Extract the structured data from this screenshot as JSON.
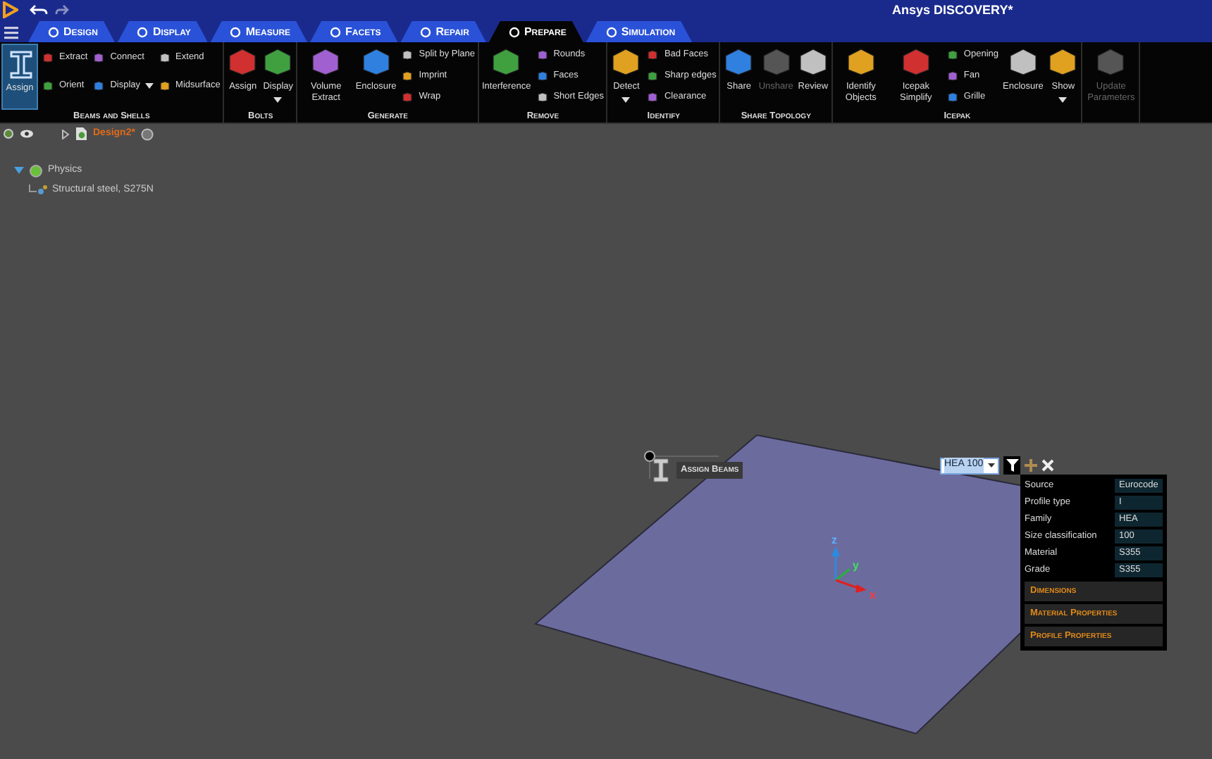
{
  "window": {
    "title": "Ansys DISCOVERY*"
  },
  "tabs": [
    {
      "label": "Design",
      "selected": false
    },
    {
      "label": "Display",
      "selected": false
    },
    {
      "label": "Measure",
      "selected": false
    },
    {
      "label": "Facets",
      "selected": false
    },
    {
      "label": "Repair",
      "selected": false
    },
    {
      "label": "Prepare",
      "selected": true
    },
    {
      "label": "Simulation",
      "selected": false
    }
  ],
  "ribbon": {
    "groups": [
      {
        "label": "Beams and Shells",
        "columns": [
          {
            "kind": "large",
            "items": [
              {
                "label": "Assign",
                "selected": true,
                "disabled": false
              }
            ]
          },
          {
            "kind": "small",
            "items": [
              {
                "label": "Extract",
                "disabled": false
              },
              {
                "label": "Orient",
                "disabled": false
              }
            ]
          },
          {
            "kind": "small",
            "items": [
              {
                "label": "Connect",
                "disabled": false
              },
              {
                "label": "Display",
                "disabled": false,
                "dropdown": true
              }
            ]
          },
          {
            "kind": "small",
            "items": [
              {
                "label": "Extend",
                "disabled": false
              },
              {
                "label": "Midsurface",
                "disabled": false
              }
            ]
          }
        ]
      },
      {
        "label": "Bolts",
        "columns": [
          {
            "kind": "large",
            "items": [
              {
                "label": "Assign",
                "selected": false,
                "disabled": false
              }
            ]
          },
          {
            "kind": "large",
            "items": [
              {
                "label": "Display",
                "selected": false,
                "disabled": false,
                "dropdown": true
              }
            ]
          }
        ]
      },
      {
        "label": "Generate",
        "columns": [
          {
            "kind": "large",
            "items": [
              {
                "label": "Volume Extract",
                "selected": false,
                "disabled": false
              }
            ]
          },
          {
            "kind": "large",
            "items": [
              {
                "label": "Enclosure",
                "selected": false,
                "disabled": false
              }
            ]
          },
          {
            "kind": "small",
            "items": [
              {
                "label": "Split by Plane",
                "disabled": false
              },
              {
                "label": "Imprint",
                "disabled": false
              },
              {
                "label": "Wrap",
                "disabled": false
              }
            ]
          }
        ]
      },
      {
        "label": "Remove",
        "columns": [
          {
            "kind": "large",
            "items": [
              {
                "label": "Interference",
                "selected": false,
                "disabled": false
              }
            ]
          },
          {
            "kind": "small",
            "items": [
              {
                "label": "Rounds",
                "disabled": false
              },
              {
                "label": "Faces",
                "disabled": false
              },
              {
                "label": "Short Edges",
                "disabled": false
              }
            ]
          }
        ]
      },
      {
        "label": "Identify",
        "columns": [
          {
            "kind": "large",
            "items": [
              {
                "label": "Detect",
                "selected": false,
                "disabled": false,
                "dropdown": true
              }
            ]
          },
          {
            "kind": "small",
            "items": [
              {
                "label": "Bad Faces",
                "disabled": false
              },
              {
                "label": "Sharp edges",
                "disabled": false
              },
              {
                "label": "Clearance",
                "disabled": false
              }
            ]
          }
        ]
      },
      {
        "label": "Share Topology",
        "columns": [
          {
            "kind": "large",
            "items": [
              {
                "label": "Share",
                "selected": false,
                "disabled": false
              }
            ]
          },
          {
            "kind": "large",
            "items": [
              {
                "label": "Unshare",
                "selected": false,
                "disabled": true
              }
            ]
          },
          {
            "kind": "large",
            "items": [
              {
                "label": "Review",
                "selected": false,
                "disabled": false
              }
            ]
          }
        ]
      },
      {
        "label": "Icepak",
        "columns": [
          {
            "kind": "large",
            "items": [
              {
                "label": "Identify Objects",
                "selected": false,
                "disabled": false
              }
            ]
          },
          {
            "kind": "large",
            "items": [
              {
                "label": "Icepak Simplify",
                "selected": false,
                "disabled": false
              }
            ]
          },
          {
            "kind": "small",
            "items": [
              {
                "label": "Opening",
                "disabled": false
              },
              {
                "label": "Fan",
                "disabled": false
              },
              {
                "label": "Grille",
                "disabled": false
              }
            ]
          },
          {
            "kind": "large",
            "items": [
              {
                "label": "Enclosure",
                "selected": false,
                "disabled": false
              }
            ]
          },
          {
            "kind": "large",
            "items": [
              {
                "label": "Show",
                "selected": false,
                "disabled": false,
                "dropdown": true
              }
            ]
          }
        ]
      },
      {
        "columns": [
          {
            "kind": "large",
            "items": [
              {
                "label": "Update Parameters",
                "selected": false,
                "disabled": true
              }
            ]
          }
        ]
      }
    ]
  },
  "tree_toolbar": {
    "document": "Design2*"
  },
  "tree": [
    {
      "label": "Physics",
      "expanded": true,
      "children": [
        {
          "label": "Structural steel, S275N"
        }
      ]
    }
  ],
  "viewport": {
    "tooltip": "Assign Beams",
    "axes": [
      "x",
      "y",
      "z"
    ]
  },
  "profile_selector": {
    "value": "HEA 100"
  },
  "properties": {
    "rows": [
      {
        "label": "Source",
        "value": "Eurocode"
      },
      {
        "label": "Profile type",
        "value": "I"
      },
      {
        "label": "Family",
        "value": "HEA"
      },
      {
        "label": "Size classification",
        "value": "100"
      },
      {
        "label": "Material",
        "value": "S355"
      },
      {
        "label": "Grade",
        "value": "S355"
      }
    ],
    "sections": [
      "Dimensions",
      "Material Properties",
      "Profile Properties"
    ]
  }
}
